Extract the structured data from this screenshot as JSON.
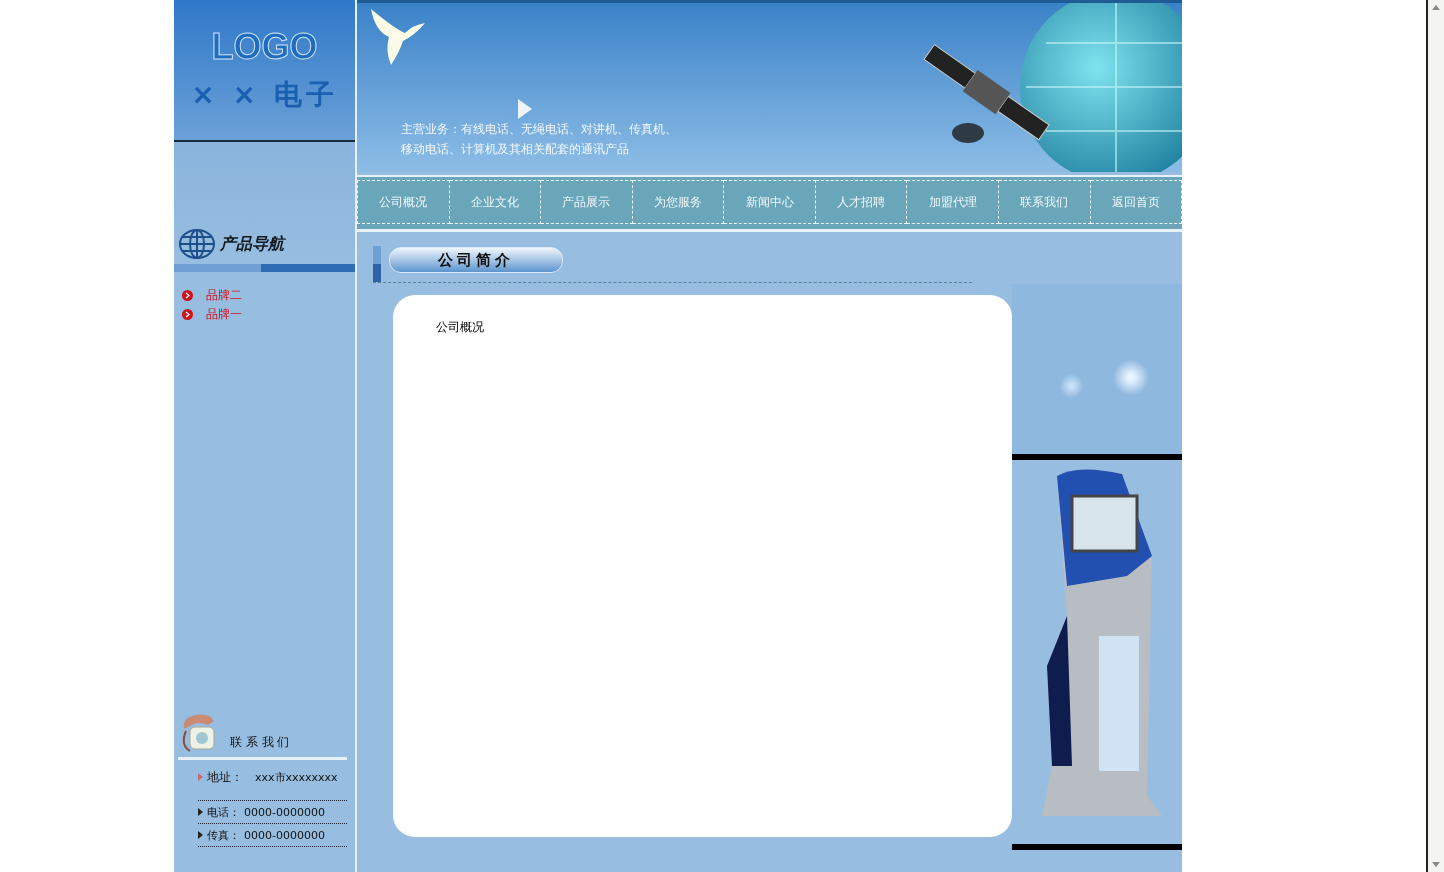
{
  "logo": {
    "mark": "LOGO",
    "name": "× × 电子"
  },
  "banner": {
    "business_lines": [
      "主营业务：有线电话、无绳电话、对讲机、传真机、",
      "移动电话、计算机及其相关配套的通讯产品"
    ]
  },
  "nav": [
    "公司概况",
    "企业文化",
    "产品展示",
    "为您服务",
    "新闻中心",
    "人才招聘",
    "加盟代理",
    "联系我们",
    "返回首页"
  ],
  "product_nav": {
    "title": "产品导航",
    "items": [
      "品牌二",
      "品牌一"
    ]
  },
  "contact": {
    "title": "联 系 我 们",
    "rows": [
      {
        "label": "地址：",
        "value": "xxx市xxxxxxxx"
      },
      {
        "label": "电话：",
        "value": "0000-0000000"
      },
      {
        "label": "传真：",
        "value": "0000-0000000"
      }
    ]
  },
  "section": {
    "title": "公司简介",
    "body": "公司概况"
  }
}
